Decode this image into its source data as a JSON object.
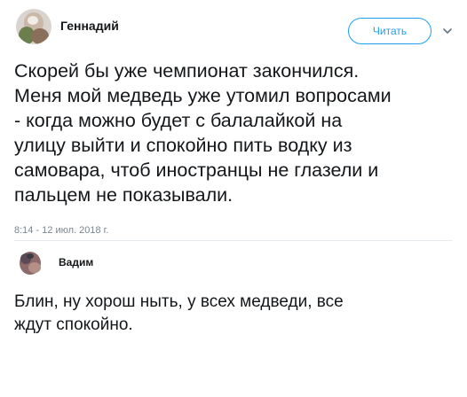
{
  "first_tweet": {
    "author": "Геннадий",
    "follow_label": "Читать",
    "lines": [
      "Скорей бы уже чемпионат закончился.",
      "Меня мой медведь уже утомил вопросами",
      "- когда можно будет с балалайкой на",
      "улицу выйти  и спокойно пить водку из",
      "самовара, чтоб иностранцы не глазели и",
      "пальцем не показывали."
    ],
    "timestamp": "8:14 - 12 июл. 2018 г.",
    "icons": {
      "avatar": "avatar-photo",
      "menu": "chevron-down-icon"
    },
    "colors": {
      "accent": "#1da1f2",
      "text": "#14171a",
      "muted": "#7a8590"
    }
  },
  "reply_tweet": {
    "author": "Вадим",
    "lines": [
      "Блин, ну хорош ныть, у всех медведи, все",
      "ждут спокойно."
    ]
  }
}
